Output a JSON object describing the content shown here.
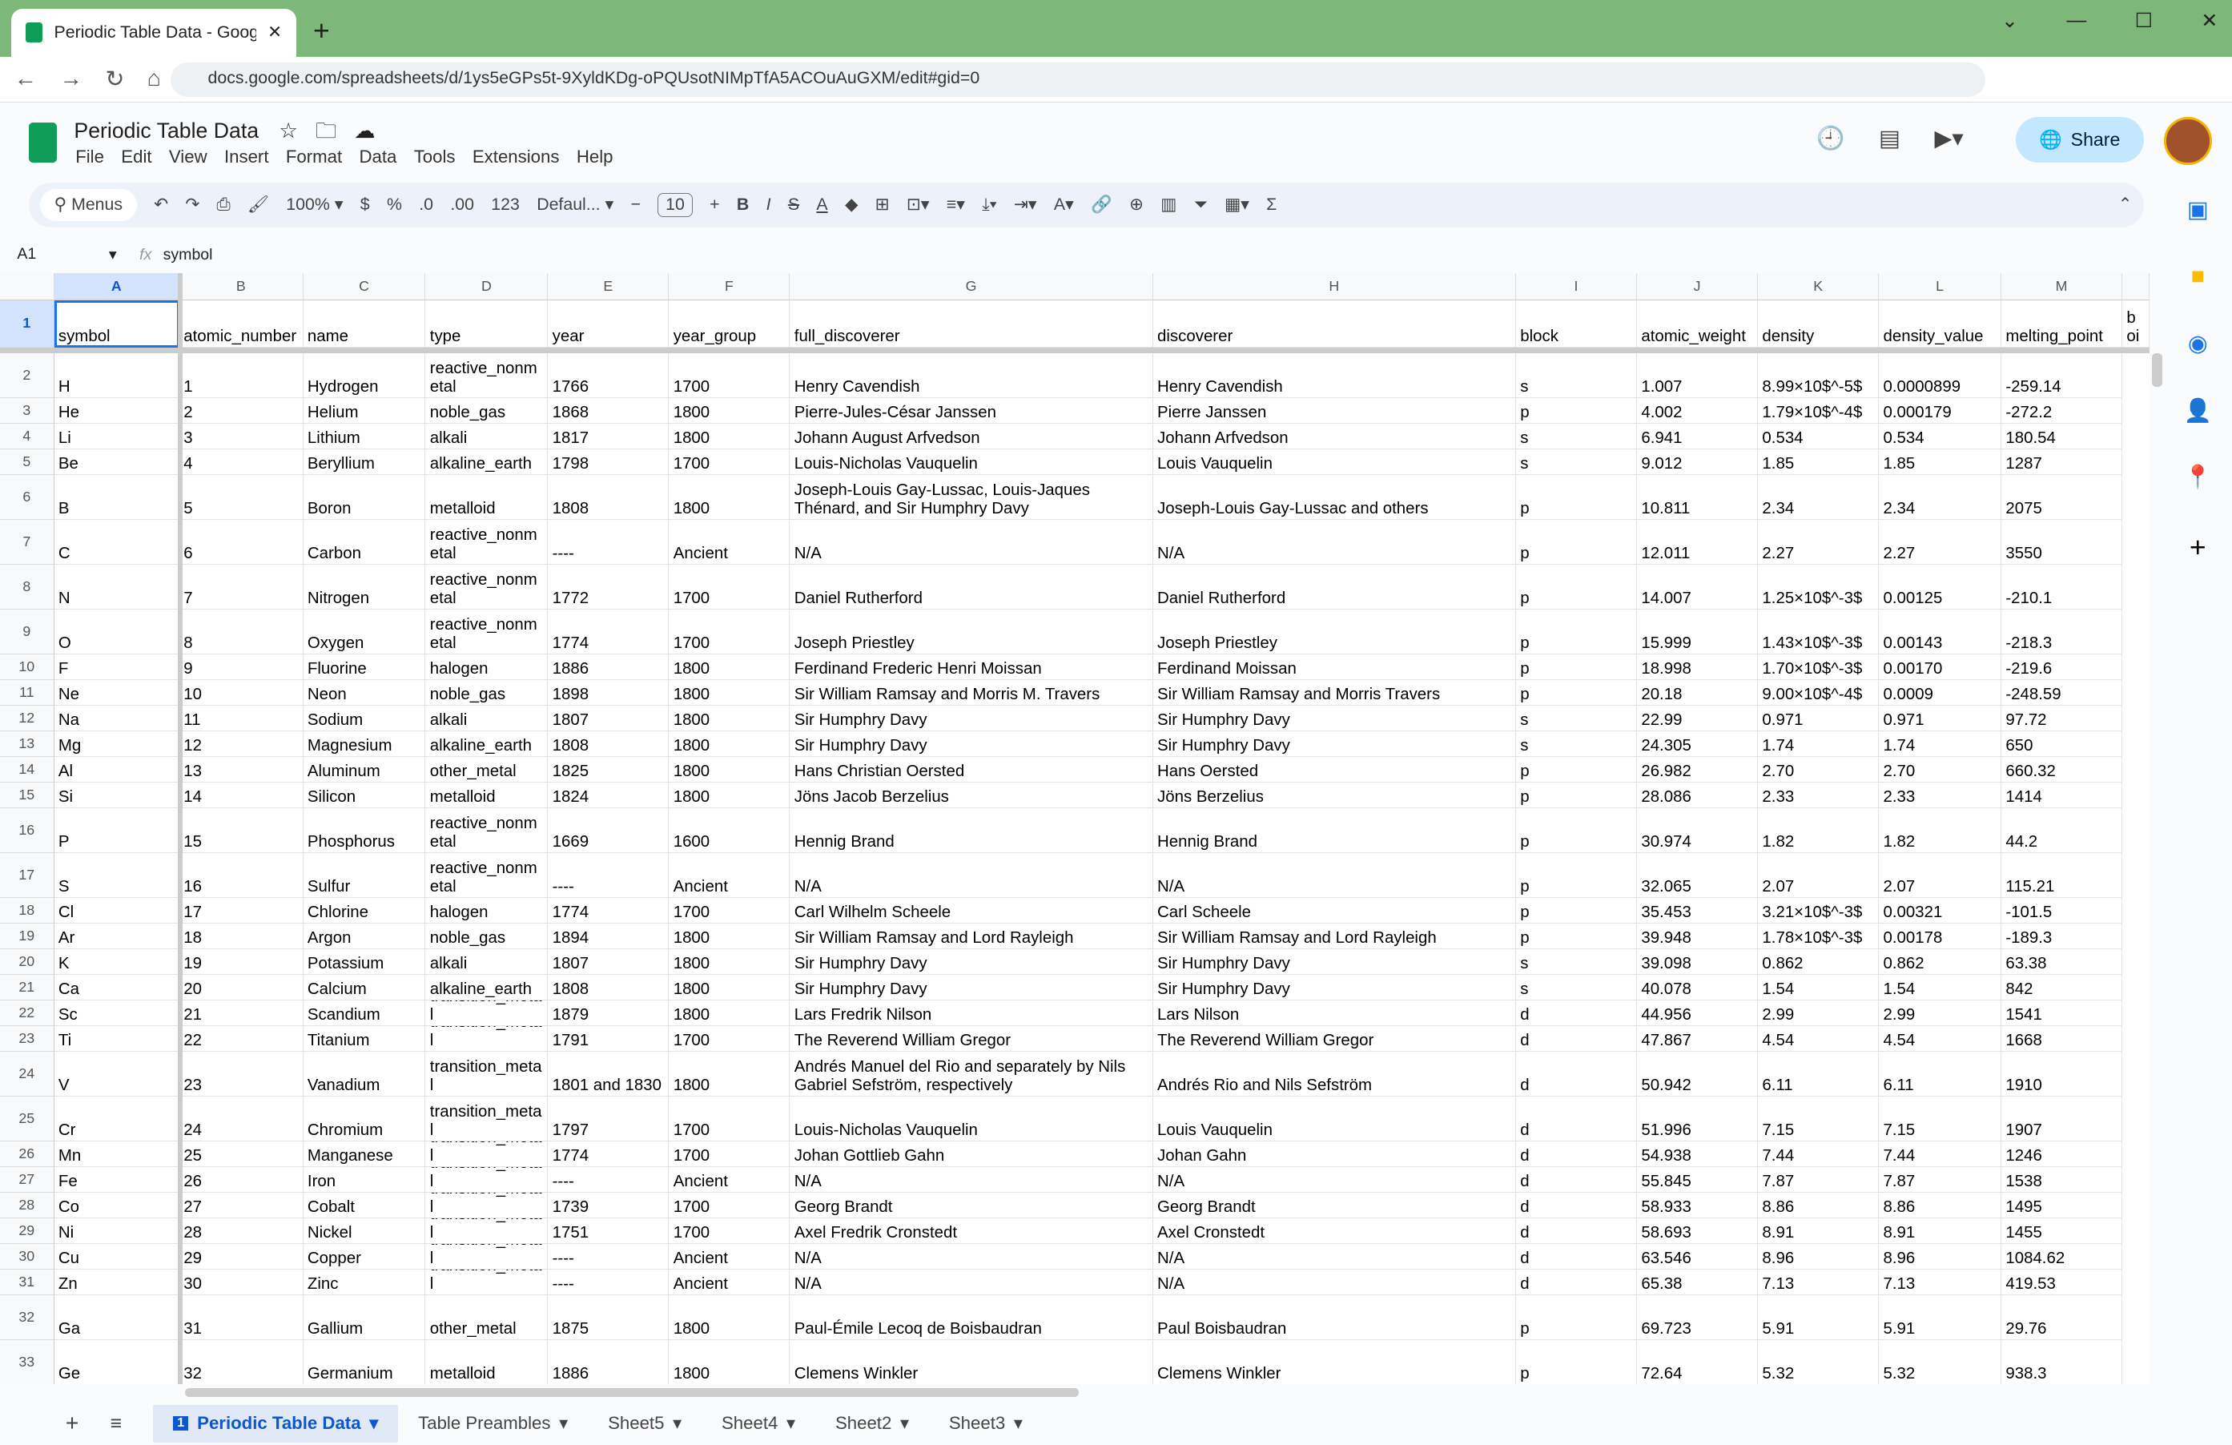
{
  "browser": {
    "tab_title": "Periodic Table Data - Google Sheets",
    "url": "docs.google.com/spreadsheets/d/1ys5eGPs5t-9XyldKDg-oPQUsotNIMpTfA5ACOuAuGXM/edit#gid=0"
  },
  "app": {
    "title": "Periodic Table Data",
    "menus": [
      "File",
      "Edit",
      "View",
      "Insert",
      "Format",
      "Data",
      "Tools",
      "Extensions",
      "Help"
    ],
    "share_label": "Share"
  },
  "toolbar": {
    "search": "Menus",
    "zoom": "100%",
    "currency": "$",
    "percent": "%",
    "dec_dec": ".0",
    "inc_dec": ".00",
    "format_num": "123",
    "font": "Defaul...",
    "font_size": "10",
    "bold": "B",
    "italic": "I",
    "strike": "S",
    "text_color": "A"
  },
  "formula_bar": {
    "cell_ref": "A1",
    "fx": "fx",
    "value": "symbol"
  },
  "columns": [
    "A",
    "B",
    "C",
    "D",
    "E",
    "F",
    "G",
    "H",
    "I",
    "J",
    "K",
    "L",
    "M",
    ""
  ],
  "header": [
    "symbol",
    "atomic_number",
    "name",
    "type",
    "year",
    "year_group",
    "full_discoverer",
    "discoverer",
    "block",
    "atomic_weight",
    "density",
    "density_value",
    "melting_point",
    "boi"
  ],
  "rows": [
    [
      "H",
      "1",
      "Hydrogen",
      "reactive_nonmetal",
      "1766",
      "1700",
      "Henry Cavendish",
      "Henry Cavendish",
      "s",
      "1.007",
      "8.99×10$^-5$",
      "0.0000899",
      "-259.14"
    ],
    [
      "He",
      "2",
      "Helium",
      "noble_gas",
      "1868",
      "1800",
      "Pierre-Jules-César Janssen",
      "Pierre Janssen",
      "p",
      "4.002",
      "1.79×10$^-4$",
      "0.000179",
      "-272.2"
    ],
    [
      "Li",
      "3",
      "Lithium",
      "alkali",
      "1817",
      "1800",
      "Johann August Arfvedson",
      "Johann Arfvedson",
      "s",
      "6.941",
      "0.534",
      "0.534",
      "180.54"
    ],
    [
      "Be",
      "4",
      "Beryllium",
      "alkaline_earth",
      "1798",
      "1700",
      "Louis-Nicholas Vauquelin",
      "Louis Vauquelin",
      "s",
      "9.012",
      "1.85",
      "1.85",
      "1287"
    ],
    [
      "B",
      "5",
      "Boron",
      "metalloid",
      "1808",
      "1800",
      "Joseph-Louis Gay-Lussac, Louis-Jaques Thénard, and Sir Humphry Davy",
      "Joseph-Louis Gay-Lussac and others",
      "p",
      "10.811",
      "2.34",
      "2.34",
      "2075"
    ],
    [
      "C",
      "6",
      "Carbon",
      "reactive_nonmetal",
      "----",
      "Ancient",
      "N/A",
      "N/A",
      "p",
      "12.011",
      "2.27",
      "2.27",
      "3550"
    ],
    [
      "N",
      "7",
      "Nitrogen",
      "reactive_nonmetal",
      "1772",
      "1700",
      "Daniel Rutherford",
      "Daniel Rutherford",
      "p",
      "14.007",
      "1.25×10$^-3$",
      "0.00125",
      "-210.1"
    ],
    [
      "O",
      "8",
      "Oxygen",
      "reactive_nonmetal",
      "1774",
      "1700",
      "Joseph Priestley",
      "Joseph Priestley",
      "p",
      "15.999",
      "1.43×10$^-3$",
      "0.00143",
      "-218.3"
    ],
    [
      "F",
      "9",
      "Fluorine",
      "halogen",
      "1886",
      "1800",
      "Ferdinand Frederic Henri Moissan",
      "Ferdinand Moissan",
      "p",
      "18.998",
      "1.70×10$^-3$",
      "0.00170",
      "-219.6"
    ],
    [
      "Ne",
      "10",
      "Neon",
      "noble_gas",
      "1898",
      "1800",
      "Sir William Ramsay and Morris M. Travers",
      "Sir William Ramsay and Morris Travers",
      "p",
      "20.18",
      "9.00×10$^-4$",
      "0.0009",
      "-248.59"
    ],
    [
      "Na",
      "11",
      "Sodium",
      "alkali",
      "1807",
      "1800",
      "Sir Humphry Davy",
      "Sir Humphry Davy",
      "s",
      "22.99",
      "0.971",
      "0.971",
      "97.72"
    ],
    [
      "Mg",
      "12",
      "Magnesium",
      "alkaline_earth",
      "1808",
      "1800",
      "Sir Humphry Davy",
      "Sir Humphry Davy",
      "s",
      "24.305",
      "1.74",
      "1.74",
      "650"
    ],
    [
      "Al",
      "13",
      "Aluminum",
      "other_metal",
      "1825",
      "1800",
      "Hans Christian Oersted",
      "Hans Oersted",
      "p",
      "26.982",
      "2.70",
      "2.70",
      "660.32"
    ],
    [
      "Si",
      "14",
      "Silicon",
      "metalloid",
      "1824",
      "1800",
      "Jöns Jacob Berzelius",
      "Jöns Berzelius",
      "p",
      "28.086",
      "2.33",
      "2.33",
      "1414"
    ],
    [
      "P",
      "15",
      "Phosphorus",
      "reactive_nonmetal",
      "1669",
      "1600",
      "Hennig Brand",
      "Hennig Brand",
      "p",
      "30.974",
      "1.82",
      "1.82",
      "44.2"
    ],
    [
      "S",
      "16",
      "Sulfur",
      "reactive_nonmetal",
      "----",
      "Ancient",
      "N/A",
      "N/A",
      "p",
      "32.065",
      "2.07",
      "2.07",
      "115.21"
    ],
    [
      "Cl",
      "17",
      "Chlorine",
      "halogen",
      "1774",
      "1700",
      "Carl Wilhelm Scheele",
      "Carl Scheele",
      "p",
      "35.453",
      "3.21×10$^-3$",
      "0.00321",
      "-101.5"
    ],
    [
      "Ar",
      "18",
      "Argon",
      "noble_gas",
      "1894",
      "1800",
      "Sir William Ramsay and Lord Rayleigh",
      "Sir William Ramsay and Lord Rayleigh",
      "p",
      "39.948",
      "1.78×10$^-3$",
      "0.00178",
      "-189.3"
    ],
    [
      "K",
      "19",
      "Potassium",
      "alkali",
      "1807",
      "1800",
      "Sir Humphry Davy",
      "Sir Humphry Davy",
      "s",
      "39.098",
      "0.862",
      "0.862",
      "63.38"
    ],
    [
      "Ca",
      "20",
      "Calcium",
      "alkaline_earth",
      "1808",
      "1800",
      "Sir Humphry Davy",
      "Sir Humphry Davy",
      "s",
      "40.078",
      "1.54",
      "1.54",
      "842"
    ],
    [
      "Sc",
      "21",
      "Scandium",
      "transition_metal",
      "1879",
      "1800",
      "Lars Fredrik Nilson",
      "Lars Nilson",
      "d",
      "44.956",
      "2.99",
      "2.99",
      "1541"
    ],
    [
      "Ti",
      "22",
      "Titanium",
      "transition_metal",
      "1791",
      "1700",
      "The Reverend William Gregor",
      "The Reverend William Gregor",
      "d",
      "47.867",
      "4.54",
      "4.54",
      "1668"
    ],
    [
      "V",
      "23",
      "Vanadium",
      "transition_metal",
      "1801 and 1830",
      "1800",
      "Andrés Manuel del Rio and separately by Nils Gabriel Sefström, respectively",
      "Andrés Rio and Nils Sefström",
      "d",
      "50.942",
      "6.11",
      "6.11",
      "1910"
    ],
    [
      "Cr",
      "24",
      "Chromium",
      "transition_metal",
      "1797",
      "1700",
      "Louis-Nicholas Vauquelin",
      "Louis Vauquelin",
      "d",
      "51.996",
      "7.15",
      "7.15",
      "1907"
    ],
    [
      "Mn",
      "25",
      "Manganese",
      "transition_metal",
      "1774",
      "1700",
      "Johan Gottlieb Gahn",
      "Johan Gahn",
      "d",
      "54.938",
      "7.44",
      "7.44",
      "1246"
    ],
    [
      "Fe",
      "26",
      "Iron",
      "transition_metal",
      "----",
      "Ancient",
      "N/A",
      "N/A",
      "d",
      "55.845",
      "7.87",
      "7.87",
      "1538"
    ],
    [
      "Co",
      "27",
      "Cobalt",
      "transition_metal",
      "1739",
      "1700",
      "Georg Brandt",
      "Georg Brandt",
      "d",
      "58.933",
      "8.86",
      "8.86",
      "1495"
    ],
    [
      "Ni",
      "28",
      "Nickel",
      "transition_metal",
      "1751",
      "1700",
      "Axel Fredrik Cronstedt",
      "Axel Cronstedt",
      "d",
      "58.693",
      "8.91",
      "8.91",
      "1455"
    ],
    [
      "Cu",
      "29",
      "Copper",
      "transition_metal",
      "----",
      "Ancient",
      "N/A",
      "N/A",
      "d",
      "63.546",
      "8.96",
      "8.96",
      "1084.62"
    ],
    [
      "Zn",
      "30",
      "Zinc",
      "transition_metal",
      "----",
      "Ancient",
      "N/A",
      "N/A",
      "d",
      "65.38",
      "7.13",
      "7.13",
      "419.53"
    ],
    [
      "Ga",
      "31",
      "Gallium",
      "other_metal",
      "1875",
      "1800",
      "Paul-Émile Lecoq de Boisbaudran",
      "Paul Boisbaudran",
      "p",
      "69.723",
      "5.91",
      "5.91",
      "29.76"
    ],
    [
      "Ge",
      "32",
      "Germanium",
      "metalloid",
      "1886",
      "1800",
      "Clemens Winkler",
      "Clemens Winkler",
      "p",
      "72.64",
      "5.32",
      "5.32",
      "938.3"
    ]
  ],
  "sheets": [
    "Periodic Table Data",
    "Table Preambles",
    "Sheet5",
    "Sheet4",
    "Sheet2",
    "Sheet3"
  ],
  "colors": {
    "accent": "#1a73e8",
    "tabbar": "#7db77a",
    "share_bg": "#c2e7ff",
    "sheets_green": "#0f9d58"
  }
}
